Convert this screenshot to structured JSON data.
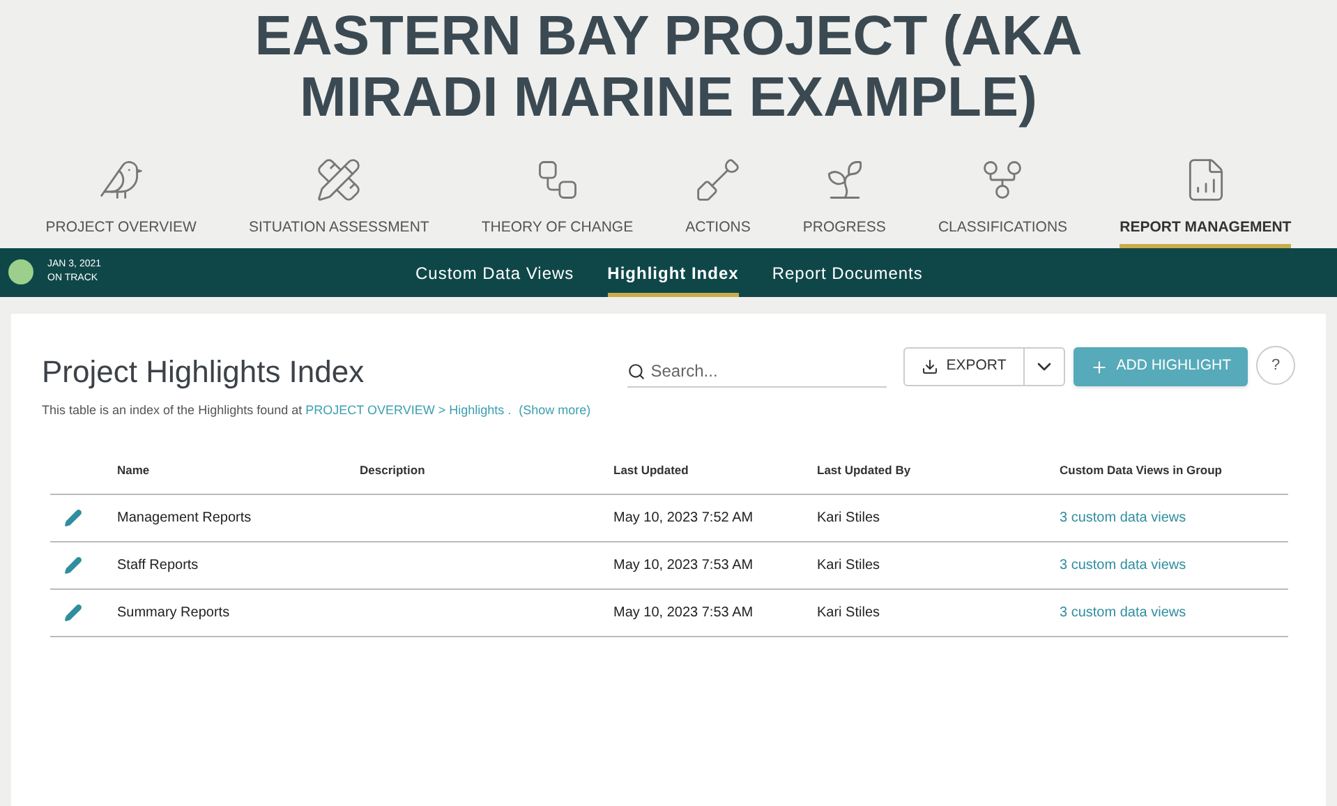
{
  "page_title": "EASTERN BAY PROJECT (AKA MIRADI MARINE EXAMPLE)",
  "main_nav": [
    {
      "label": "PROJECT OVERVIEW",
      "selected": false
    },
    {
      "label": "SITUATION ASSESSMENT",
      "selected": false
    },
    {
      "label": "THEORY OF CHANGE",
      "selected": false
    },
    {
      "label": "ACTIONS",
      "selected": false
    },
    {
      "label": "PROGRESS",
      "selected": false
    },
    {
      "label": "CLASSIFICATIONS",
      "selected": false
    },
    {
      "label": "REPORT MANAGEMENT",
      "selected": true
    }
  ],
  "status": {
    "date": "JAN 3, 2021",
    "label": "ON TRACK",
    "color": "#9dcf8c"
  },
  "sub_tabs": [
    {
      "label": "Custom Data Views",
      "selected": false
    },
    {
      "label": "Highlight Index",
      "selected": true
    },
    {
      "label": "Report Documents",
      "selected": false
    }
  ],
  "heading": "Project Highlights Index",
  "description": {
    "text": "This table is an index of the Highlights found at",
    "link": "PROJECT OVERVIEW > Highlights .",
    "more": "(Show more)"
  },
  "search": {
    "placeholder": "Search..."
  },
  "export_button": "EXPORT",
  "add_button": "ADD HIGHLIGHT",
  "help_button": "?",
  "table": {
    "columns": [
      "Name",
      "Description",
      "Last Updated",
      "Last Updated By",
      "Custom Data Views in Group"
    ],
    "rows": [
      {
        "name": "Management Reports",
        "updated": "May 10, 2023 7:52 AM",
        "by": "Kari Stiles",
        "views": "3 custom data views"
      },
      {
        "name": "Staff Reports",
        "updated": "May 10, 2023 7:53 AM",
        "by": "Kari Stiles",
        "views": "3 custom data views"
      },
      {
        "name": "Summary Reports",
        "updated": "May 10, 2023 7:53 AM",
        "by": "Kari Stiles",
        "views": "3 custom data views"
      }
    ]
  }
}
